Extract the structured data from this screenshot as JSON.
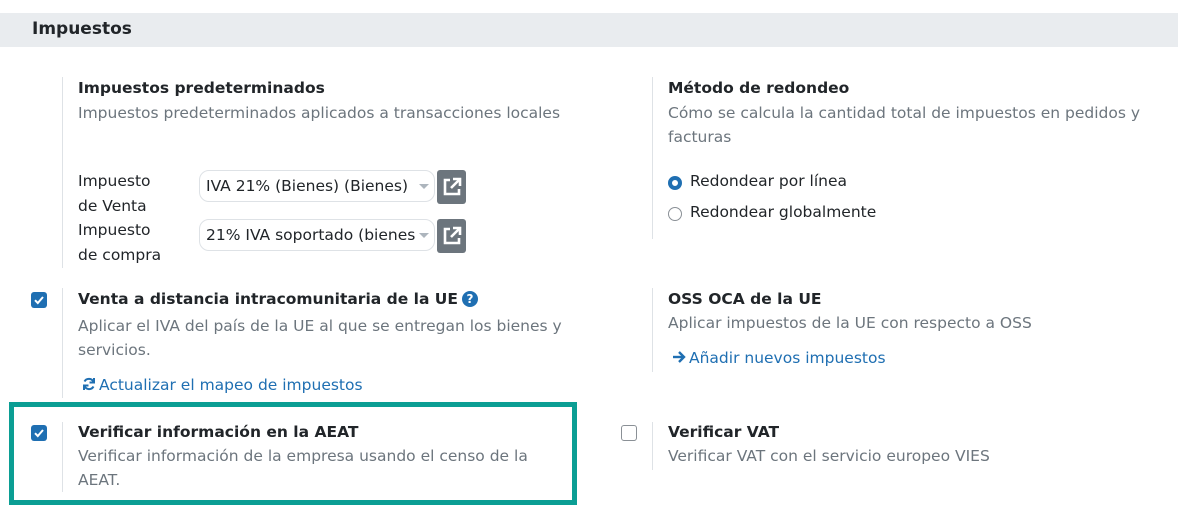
{
  "section": {
    "title": "Impuestos"
  },
  "default_taxes": {
    "title": "Impuestos predeterminados",
    "description": "Impuestos predeterminados aplicados a transacciones locales",
    "sale_label_1": "Impuesto",
    "sale_label_2": "de Venta",
    "sale_value": "IVA 21% (Bienes) (Bienes)",
    "purchase_label_1": "Impuesto",
    "purchase_label_2": "de compra",
    "purchase_value": "21% IVA soportado (bienes",
    "external_link_icon": "external-link-icon"
  },
  "rounding": {
    "title": "Método de redondeo",
    "description": "Cómo se calcula la cantidad total de impuestos en pedidos y facturas",
    "options": [
      {
        "label": "Redondear por línea",
        "selected": true
      },
      {
        "label": "Redondear globalmente",
        "selected": false
      }
    ]
  },
  "eu_distance": {
    "title": "Venta a distancia intracomunitaria de la UE",
    "help_icon": "?",
    "checked": true,
    "description": "Aplicar el IVA del país de la UE al que se entregan los bienes y servicios.",
    "link": "Actualizar el mapeo de impuestos"
  },
  "oss": {
    "title": "OSS OCA de la UE",
    "description": "Aplicar impuestos de la UE con respecto a OSS",
    "link": "Añadir nuevos impuestos"
  },
  "aeat": {
    "title": "Verificar información en la AEAT",
    "checked": true,
    "description": "Verificar información de la empresa usando el censo de la AEAT."
  },
  "vat": {
    "title": "Verificar VAT",
    "checked": false,
    "description": "Verificar VAT con el servicio europeo VIES"
  },
  "colors": {
    "accent": "#1f6fb2",
    "highlight": "#0b9e94",
    "muted": "#6c757d"
  }
}
